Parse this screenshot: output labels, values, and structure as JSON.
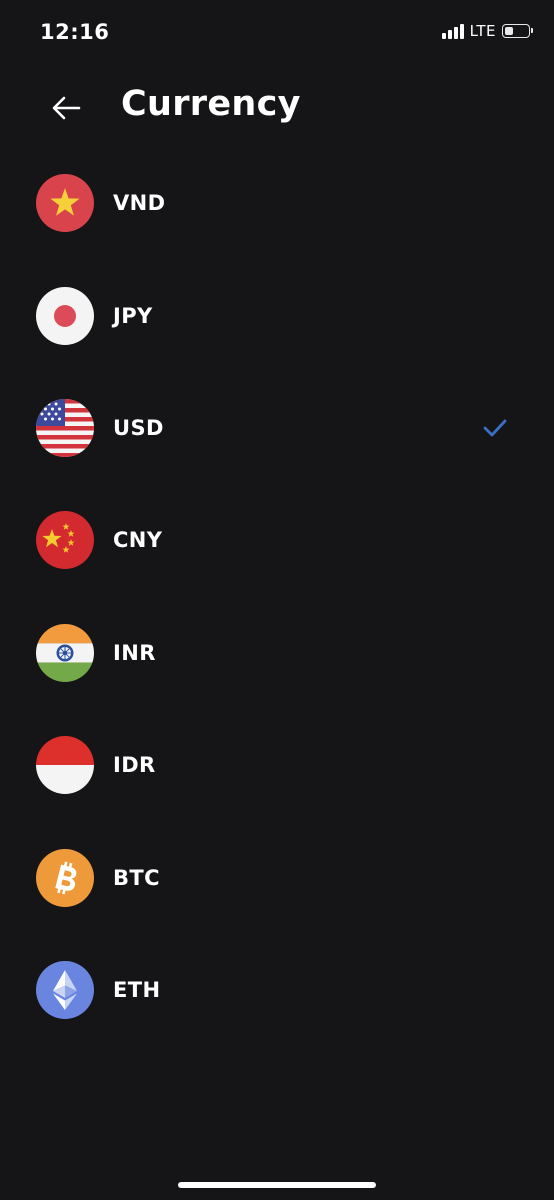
{
  "status_bar": {
    "time": "12:16",
    "network": "LTE",
    "battery_level": 0.4
  },
  "header": {
    "title": "Currency"
  },
  "currencies": [
    {
      "code": "VND",
      "flag": "vietnam-flag-icon",
      "selected": false
    },
    {
      "code": "JPY",
      "flag": "japan-flag-icon",
      "selected": false
    },
    {
      "code": "USD",
      "flag": "usa-flag-icon",
      "selected": true
    },
    {
      "code": "CNY",
      "flag": "china-flag-icon",
      "selected": false
    },
    {
      "code": "INR",
      "flag": "india-flag-icon",
      "selected": false
    },
    {
      "code": "IDR",
      "flag": "indonesia-flag-icon",
      "selected": false
    },
    {
      "code": "BTC",
      "flag": "bitcoin-icon",
      "selected": false
    },
    {
      "code": "ETH",
      "flag": "ethereum-icon",
      "selected": false
    }
  ],
  "colors": {
    "background": "#151517",
    "text": "#ffffff",
    "check": "#3b6fc4"
  }
}
